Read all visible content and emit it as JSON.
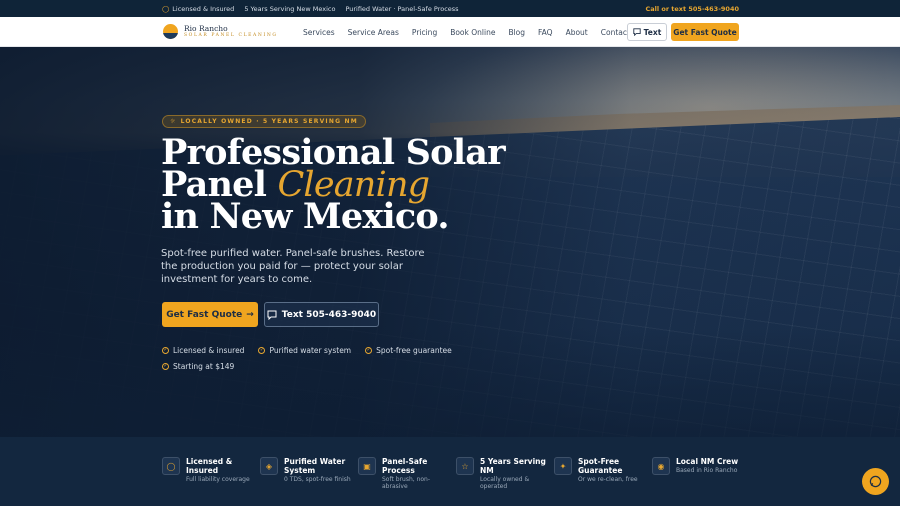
{
  "topbar": {
    "items": [
      "Licensed & Insured",
      "5 Years Serving New Mexico",
      "Purified Water · Panel-Safe Process"
    ],
    "call": "Call or text 505-463-9040"
  },
  "logo": {
    "name": "Rio Rancho",
    "sub": "SOLAR PANEL CLEANING"
  },
  "nav": {
    "links": [
      "Services",
      "Service Areas",
      "Pricing",
      "Book Online",
      "Blog",
      "FAQ",
      "About",
      "Contact"
    ],
    "text_button": "Text",
    "quote_button": "Get Fast Quote"
  },
  "hero": {
    "badge": "LOCALLY OWNED · 5 YEARS SERVING NM",
    "title_line1": "Professional Solar",
    "title_line2a": "Panel ",
    "title_line2b": "Cleaning",
    "title_line3": "in New Mexico.",
    "lead": "Spot-free purified water. Panel-safe brushes. Restore the production you paid for — protect your solar investment for years to come.",
    "cta_primary": "Get Fast Quote",
    "cta_secondary": "Text 505-463-9040",
    "checks": [
      "Licensed & insured",
      "Purified water system",
      "Spot-free guarantee",
      "Starting at $149"
    ]
  },
  "features": [
    {
      "title": "Licensed & Insured",
      "sub": "Full liability coverage",
      "icon": "shield-icon"
    },
    {
      "title": "Purified Water System",
      "sub": "0 TDS, spot-free finish",
      "icon": "droplets-icon"
    },
    {
      "title": "Panel-Safe Process",
      "sub": "Soft brush, non-abrasive",
      "icon": "lock-icon"
    },
    {
      "title": "5 Years Serving NM",
      "sub": "Locally owned & operated",
      "icon": "award-icon"
    },
    {
      "title": "Spot-Free Guarantee",
      "sub": "Or we re-clean, free",
      "icon": "sparkle-icon"
    },
    {
      "title": "Local NM Crew",
      "sub": "Based in Rio Rancho",
      "icon": "map-pin-icon"
    }
  ],
  "colors": {
    "accent": "#f0a51f",
    "navy": "#13273f",
    "topbar": "#0f2438"
  }
}
